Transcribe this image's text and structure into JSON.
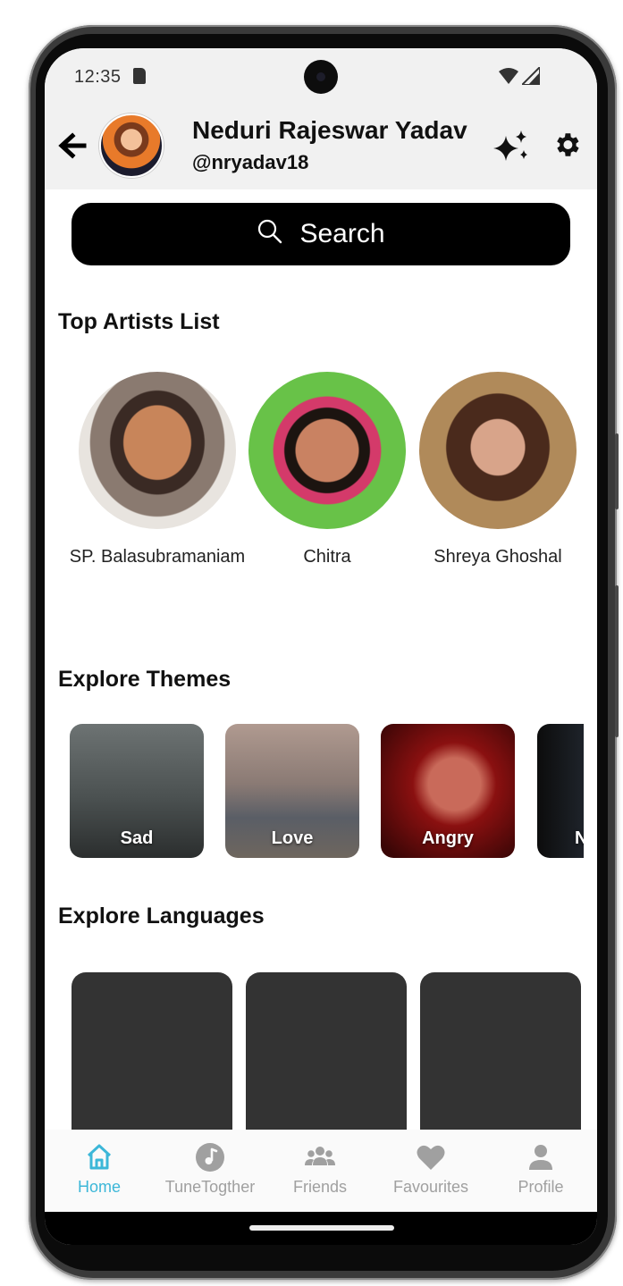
{
  "status_bar": {
    "time": "12:35"
  },
  "header": {
    "name": "Neduri Rajeswar Yadav",
    "handle": "@nryadav18"
  },
  "search": {
    "label": "Search"
  },
  "sections": {
    "artists_title": "Top Artists List",
    "themes_title": "Explore Themes",
    "languages_title": "Explore Languages"
  },
  "artists": [
    {
      "name": "SP. Balasubramaniam"
    },
    {
      "name": "Chitra"
    },
    {
      "name": "Shreya Ghoshal"
    }
  ],
  "themes": [
    {
      "label": "Sad"
    },
    {
      "label": "Love"
    },
    {
      "label": "Angry"
    },
    {
      "label": "N"
    }
  ],
  "nav": [
    {
      "label": "Home",
      "icon": "home-icon",
      "active": true
    },
    {
      "label": "TuneTogther",
      "icon": "music-note-icon",
      "active": false
    },
    {
      "label": "Friends",
      "icon": "group-icon",
      "active": false
    },
    {
      "label": "Favourites",
      "icon": "heart-icon",
      "active": false
    },
    {
      "label": "Profile",
      "icon": "person-icon",
      "active": false
    }
  ],
  "colors": {
    "accent": "#3cb7d8",
    "header_bg": "#f1f1f1",
    "search_bg": "#000000",
    "placeholder_card": "#333333",
    "nav_inactive": "#a0a0a0"
  }
}
